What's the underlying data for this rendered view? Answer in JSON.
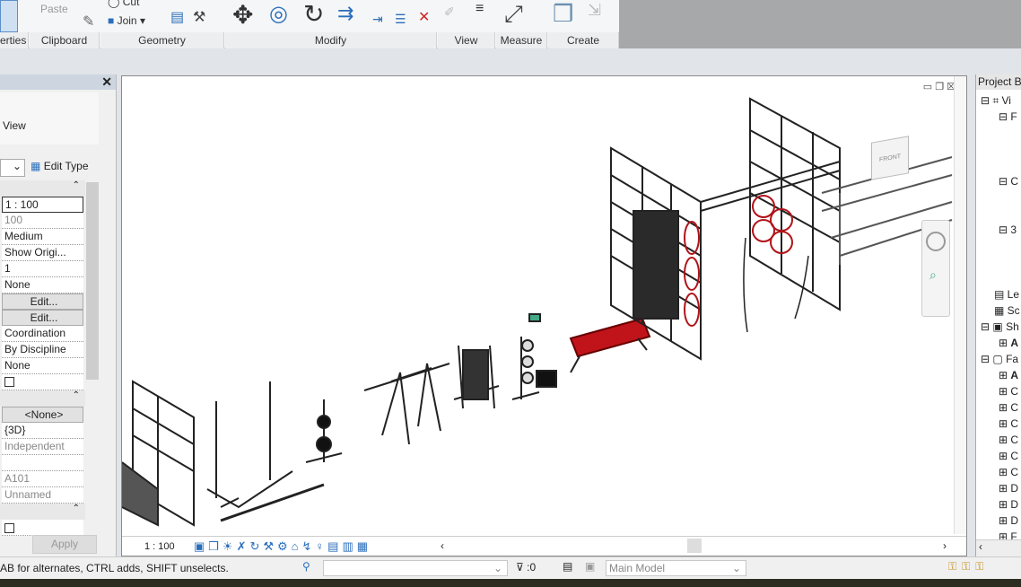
{
  "ribbon": {
    "panels": [
      "erties",
      "Clipboard",
      "Geometry",
      "Modify",
      "View",
      "Measure",
      "Create"
    ],
    "paste_label": "Paste",
    "cut_label": "Cut",
    "join_label": "Join"
  },
  "properties": {
    "view_label": "View",
    "edit_type_label": "Edit Type",
    "rows_graphics": [
      "1 : 100",
      "100",
      "Medium",
      "Show Origi...",
      "1",
      "None",
      "Edit...",
      "Edit...",
      "Coordination",
      "By Discipline",
      "None"
    ],
    "rows_identity": [
      "<None>",
      "{3D}",
      "Independent",
      "",
      "A101",
      "Unnamed"
    ],
    "apply_label": "Apply"
  },
  "viewport": {
    "scale_label": "1 : 100",
    "viewcube_label": "FRONT"
  },
  "browser": {
    "title": "Project Br",
    "items": [
      "Vi",
      "F",
      "C",
      "3",
      "Le",
      "Sc",
      "Sh",
      "A",
      "Fa",
      "A",
      "C",
      "C",
      "C",
      "C",
      "C",
      "C",
      "D",
      "D",
      "D",
      "F"
    ]
  },
  "status": {
    "message": "AB for alternates, CTRL adds, SHIFT unselects.",
    "filter_count": ":0",
    "model_label": "Main Model"
  },
  "colors": {
    "accent": "#2a6ebb",
    "bench_red": "#c0141a"
  }
}
